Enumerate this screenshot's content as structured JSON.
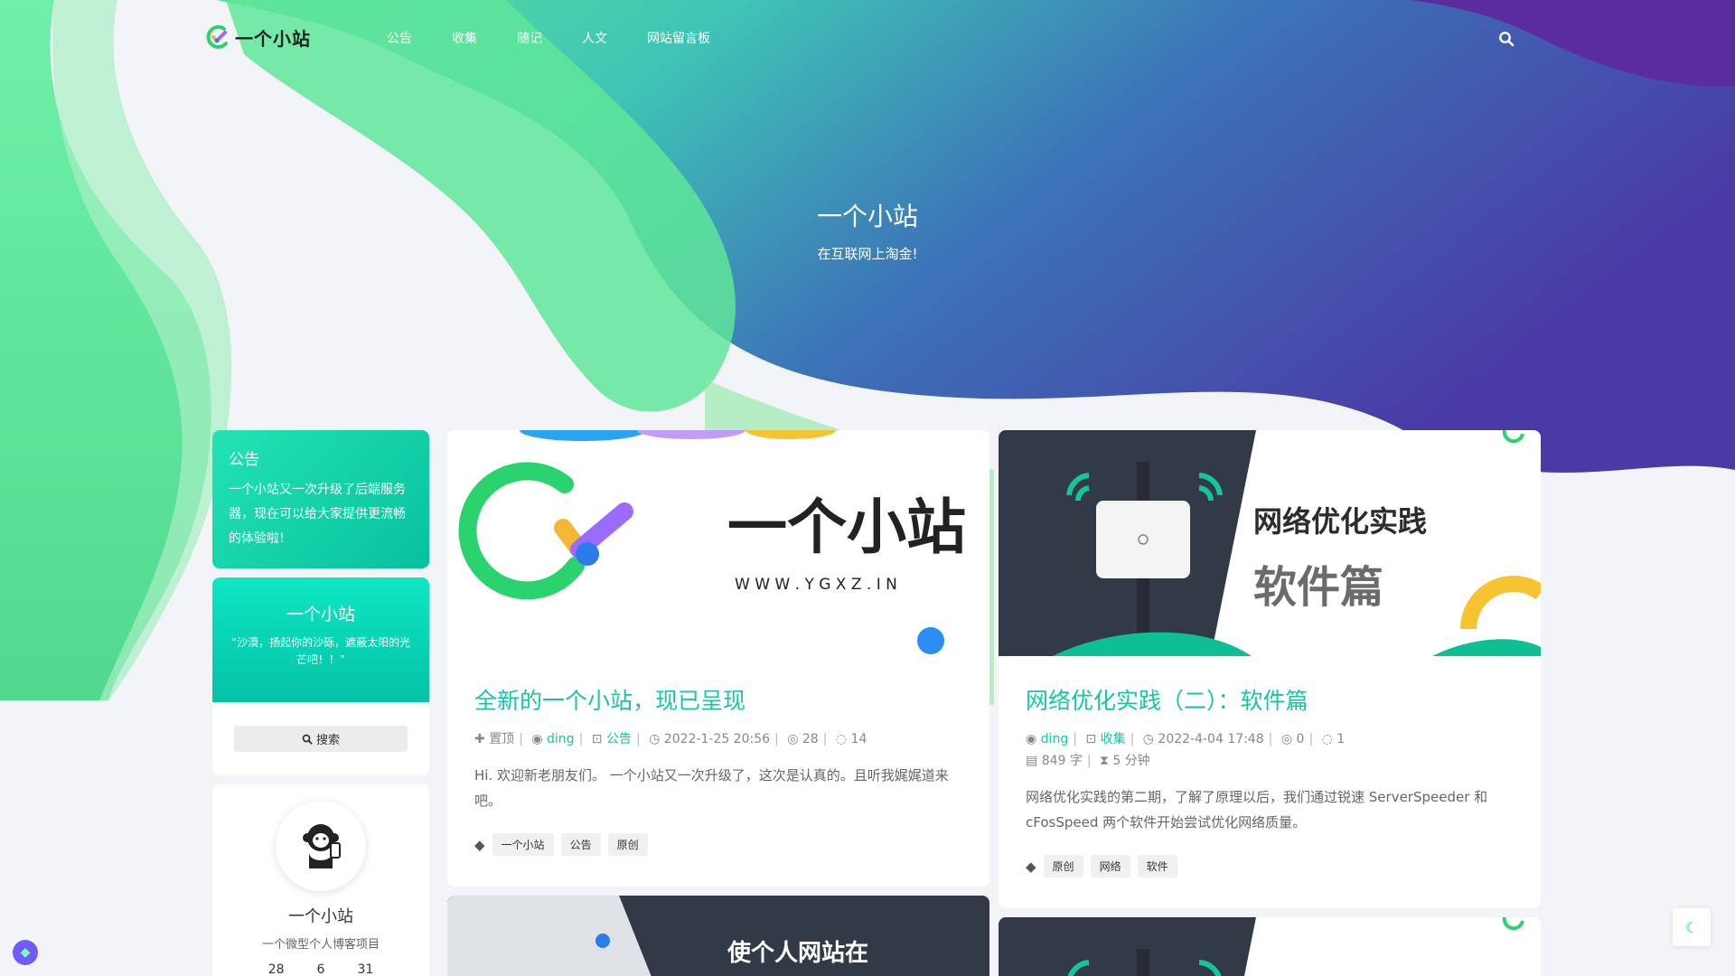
{
  "header": {
    "logo_text": "一个小站",
    "nav": [
      "公告",
      "收集",
      "随记",
      "人文",
      "网站留言板"
    ]
  },
  "hero": {
    "title": "一个小站",
    "subtitle": "在互联网上淘金!"
  },
  "sidebar": {
    "notice": {
      "title": "公告",
      "text": "一个小站又一次升级了后端服务器，现在可以给大家提供更流畅的体验啦!"
    },
    "search_widget": {
      "title": "一个小站",
      "quote": "“沙漠，扬起你的沙砾，遮蔽太阳的光芒吧！！”",
      "button_label": "搜索"
    },
    "profile": {
      "name": "一个小站",
      "desc": "一个微型个人博客项目",
      "stats": [
        "28",
        "6",
        "31"
      ]
    }
  },
  "posts": [
    {
      "thumb_title": "一个小站",
      "thumb_url": "W W W . Y G X Z . I N",
      "title": "全新的一个小站，现已呈现",
      "meta": {
        "pinned": "置顶",
        "author": "ding",
        "category": "公告",
        "date": "2022-1-25 20:56",
        "views": "28",
        "comments": "14"
      },
      "excerpt": "Hi. 欢迎新老朋友们。 一个小站又一次升级了，这次是认真的。且听我娓娓道来吧。",
      "tags": [
        "一个小站",
        "公告",
        "原创"
      ]
    },
    {
      "thumb_title": "网络优化实践",
      "thumb_subtitle": "软件篇",
      "title": "网络优化实践（二）：软件篇",
      "meta": {
        "author": "ding",
        "category": "收集",
        "date": "2022-4-04 17:48",
        "views": "0",
        "comments": "1",
        "words": "849 字",
        "read_time": "5 分钟"
      },
      "excerpt": "网络优化实践的第二期，了解了原理以后，我们通过锐速 ServerSpeeder 和 cFosSpeed 两个软件开始尝试优化网络质量。",
      "tags": [
        "原创",
        "网络",
        "软件"
      ]
    },
    {
      "thumb_title": "使个人网站在"
    }
  ],
  "colors": {
    "accent": "#16c6a4",
    "hero_green": "#5ee59a",
    "hero_blue": "#3f59b0",
    "hero_purple": "#5b2fa3"
  }
}
